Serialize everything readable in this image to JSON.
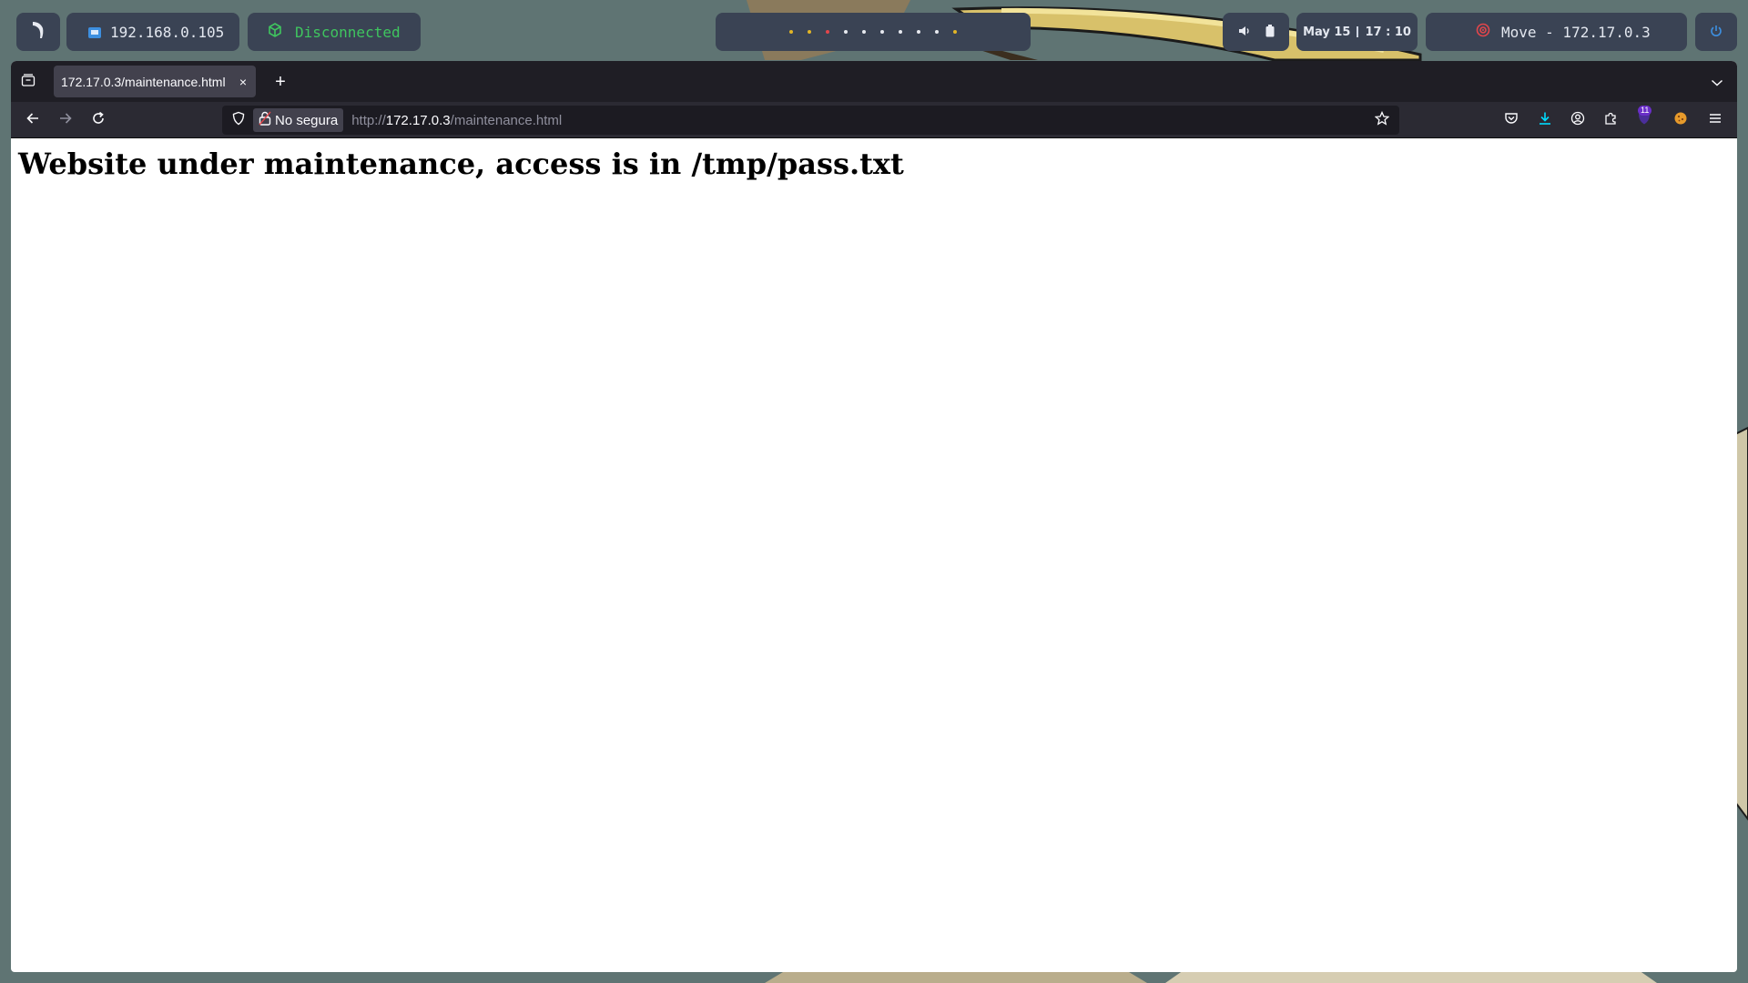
{
  "taskbar": {
    "local_ip": "192.168.0.105",
    "vpn_status": "Disconnected",
    "date": "May 15",
    "time": "17 : 10",
    "target_label": "Move - 172.17.0.3",
    "workspace_count": 10,
    "icons": {
      "logo": "kali-dragon-icon",
      "ip": "network-card-icon",
      "vpn": "cube-icon",
      "volume": "speaker-icon",
      "battery": "battery-icon",
      "target": "target-icon",
      "power": "power-icon"
    },
    "colors": {
      "pill_bg": "#3a4354",
      "vpn_green": "#3fc55f",
      "dot_yellow": "#e2b526",
      "dot_red": "#e2464b",
      "target_red": "#e2464b"
    }
  },
  "browser": {
    "tab": {
      "title": "172.17.0.3/maintenance.html",
      "close_symbol": "×"
    },
    "new_tab_symbol": "+",
    "security_label": "No segura",
    "url": {
      "scheme": "http://",
      "host": "172.17.0.3",
      "path": "/maintenance.html"
    },
    "extension_badge": "11",
    "colors": {
      "tabbar_bg": "#1f1e25",
      "navbar_bg": "#2b2a33",
      "urlbar_bg": "#1c1b22",
      "download_blue": "#00ddff"
    }
  },
  "page": {
    "heading": "Website under maintenance, access is in /tmp/pass.txt"
  }
}
